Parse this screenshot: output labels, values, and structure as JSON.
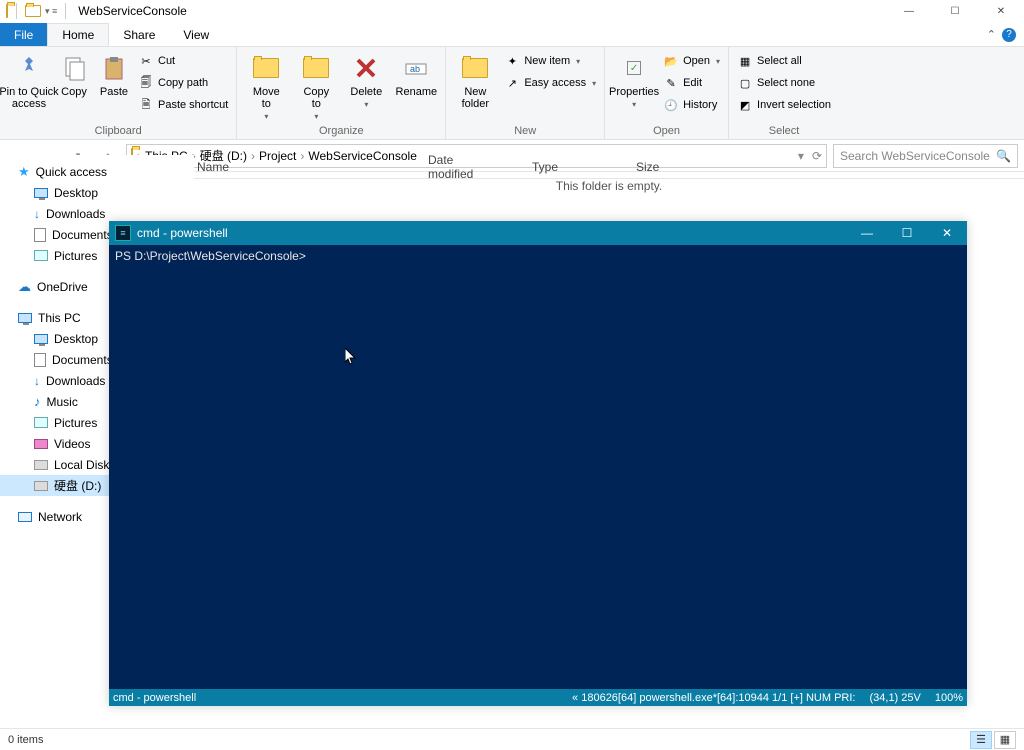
{
  "window": {
    "title": "WebServiceConsole",
    "controls": {
      "min": "—",
      "max": "☐",
      "close": "✕"
    }
  },
  "tabs": {
    "file": "File",
    "home": "Home",
    "share": "Share",
    "view": "View"
  },
  "ribbon": {
    "clipboard": {
      "label": "Clipboard",
      "pin": "Pin to Quick\naccess",
      "copy": "Copy",
      "paste": "Paste",
      "cut": "Cut",
      "copypath": "Copy path",
      "pasteshort": "Paste shortcut"
    },
    "organize": {
      "label": "Organize",
      "moveto": "Move\nto",
      "copyto": "Copy\nto",
      "delete": "Delete",
      "rename": "Rename"
    },
    "new": {
      "label": "New",
      "newfolder": "New\nfolder",
      "newitem": "New item",
      "easyaccess": "Easy access"
    },
    "open": {
      "label": "Open",
      "properties": "Properties",
      "open": "Open",
      "edit": "Edit",
      "history": "History"
    },
    "select": {
      "label": "Select",
      "all": "Select all",
      "none": "Select none",
      "invert": "Invert selection"
    }
  },
  "breadcrumb": [
    "This PC",
    "硬盘 (D:)",
    "Project",
    "WebServiceConsole"
  ],
  "search": {
    "placeholder": "Search WebServiceConsole"
  },
  "columns": {
    "name": "Name",
    "date": "Date modified",
    "type": "Type",
    "size": "Size"
  },
  "empty": "This folder is empty.",
  "nav": {
    "quick": "Quick access",
    "desktop": "Desktop",
    "downloads": "Downloads",
    "documents": "Documents",
    "pictures": "Pictures",
    "onedrive": "OneDrive",
    "thispc": "This PC",
    "pc_desktop": "Desktop",
    "pc_documents": "Documents",
    "pc_downloads": "Downloads",
    "pc_music": "Music",
    "pc_pictures": "Pictures",
    "pc_videos": "Videos",
    "pc_localc": "Local Disk (C:)",
    "pc_diskd": "硬盘 (D:)",
    "network": "Network"
  },
  "status": {
    "items": "0 items"
  },
  "console": {
    "title": "cmd - powershell",
    "prompt": "PS D:\\Project\\WebServiceConsole>",
    "status_left": "cmd - powershell",
    "status_mid": "« 180626[64] powershell.exe*[64]:10944   1/1   [+]  NUM   PRI:",
    "status_pos": "(34,1) 25V",
    "status_pct": "100%"
  }
}
